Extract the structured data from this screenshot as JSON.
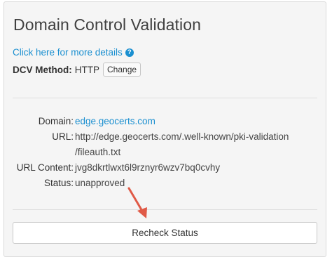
{
  "panel": {
    "title": "Domain Control Validation",
    "details_link": "Click here for more details",
    "help_icon_glyph": "?",
    "dcv": {
      "label": "DCV Method:",
      "value": "HTTP",
      "change_label": "Change"
    },
    "fields": {
      "domain": {
        "label": "Domain:",
        "value": "edge.geocerts.com"
      },
      "url": {
        "label": "URL:",
        "value_line1": "http://edge.geocerts.com/.well-known/pki-validation",
        "value_line2": "/fileauth.txt"
      },
      "url_content": {
        "label": "URL Content:",
        "value": "jvg8dkrtlwxt6l9rznyr6wzv7bq0cvhy"
      },
      "status": {
        "label": "Status:",
        "value": "unapproved"
      }
    },
    "recheck_label": "Recheck Status"
  },
  "colors": {
    "link": "#1a8fd0",
    "arrow": "#e05a47",
    "panel_bg": "#f5f5f5"
  },
  "icons": {
    "help": "question-circle-icon",
    "annotation": "red-arrow-icon"
  }
}
